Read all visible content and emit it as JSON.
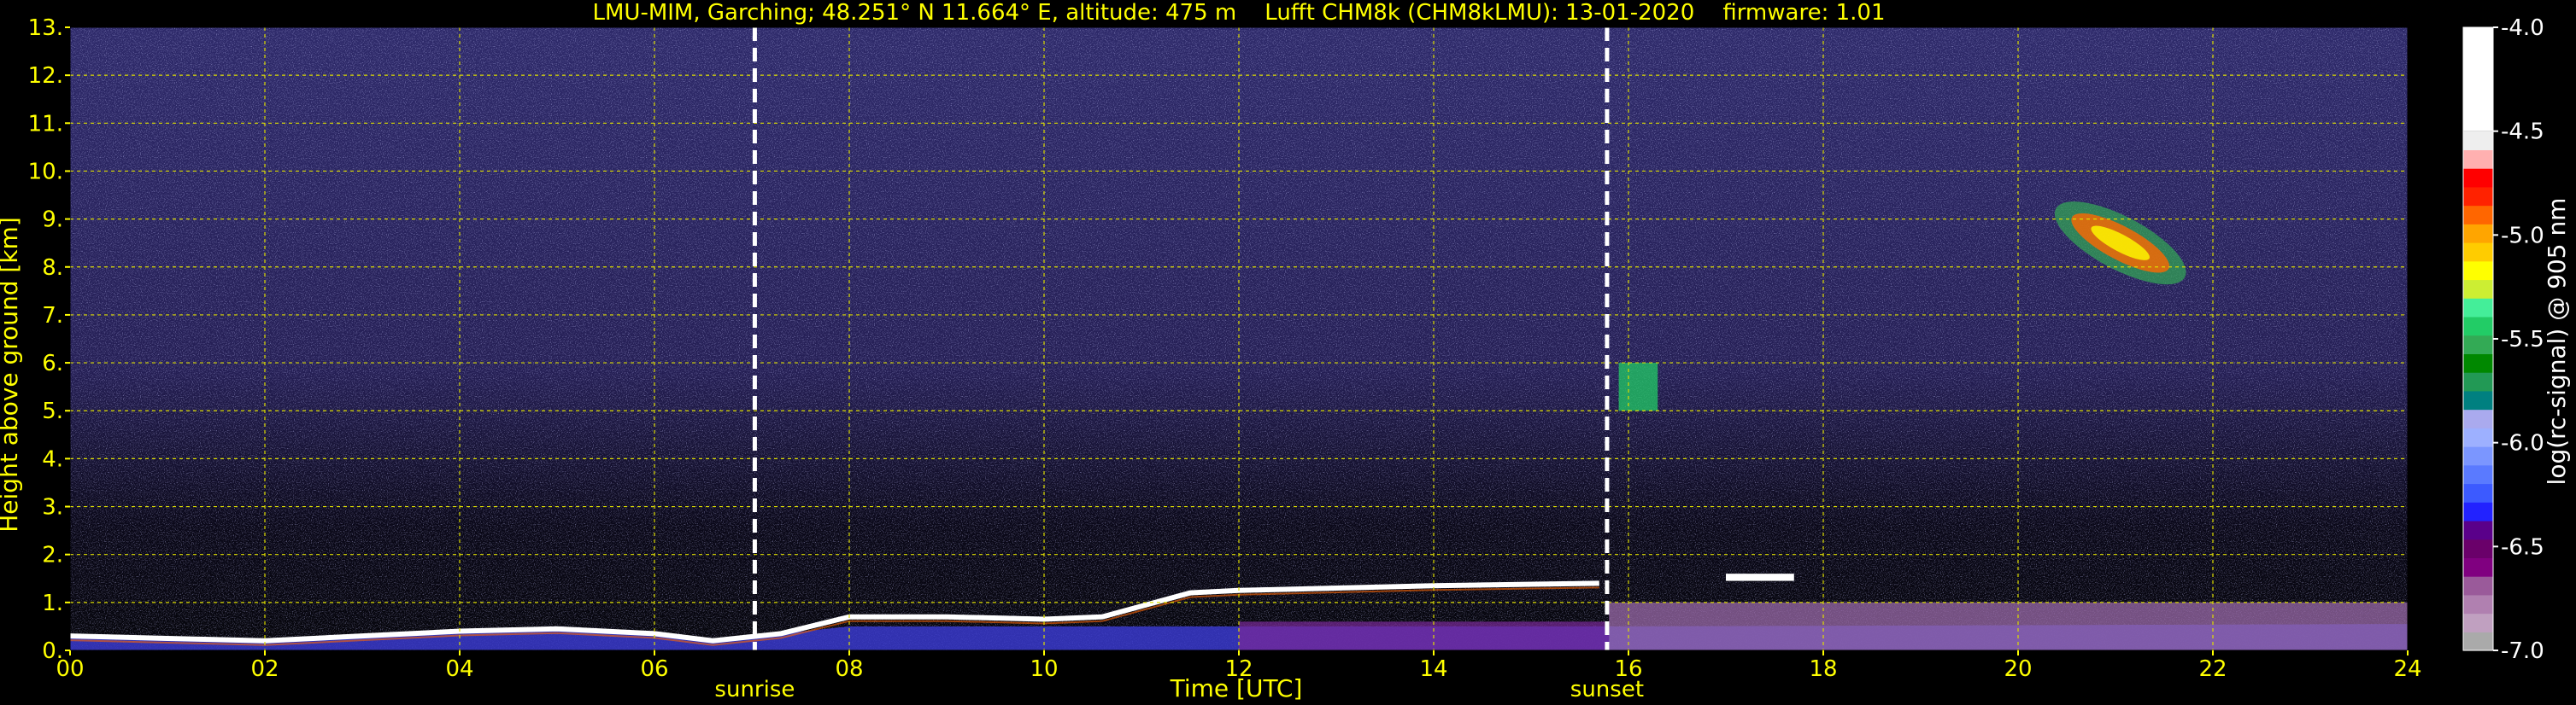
{
  "title": "LMU-MIM, Garching; 48.251° N 11.664° E, altitude: 475 m    Lufft CHM8k (CHM8kLMU): 13-01-2020    firmware: 1.01",
  "chart_data": {
    "type": "heatmap",
    "title": "LMU-MIM, Garching; 48.251° N 11.664° E, altitude: 475 m    Lufft CHM8k (CHM8kLMU): 13-01-2020    firmware: 1.01",
    "xlabel": "Time [UTC]",
    "ylabel": "Height above ground [km]",
    "xlim": [
      0,
      24
    ],
    "ylim": [
      0,
      13
    ],
    "x_ticks": [
      "00",
      "02",
      "04",
      "06",
      "08",
      "10",
      "12",
      "14",
      "16",
      "18",
      "20",
      "22",
      "24"
    ],
    "y_ticks": [
      "0.",
      "1.",
      "2.",
      "3.",
      "4.",
      "5.",
      "6.",
      "7.",
      "8.",
      "9.",
      "10.",
      "11.",
      "12.",
      "13."
    ],
    "grid": true,
    "colorbar": {
      "label": "log(rc-signal) @ 905 nm",
      "range": [
        -7.0,
        -4.0
      ],
      "ticks": [
        "-7.0",
        "-6.5",
        "-6.0",
        "-5.5",
        "-5.0",
        "-4.5",
        "-4.0"
      ],
      "colors": [
        "#aaaaaa",
        "#c0a0c0",
        "#b080b0",
        "#9a5a9a",
        "#800080",
        "#6a006a",
        "#5a008a",
        "#2222ff",
        "#3c5aff",
        "#5a7aff",
        "#7b96ff",
        "#9db0ff",
        "#aaaaee",
        "#008080",
        "#229955",
        "#008800",
        "#33aa55",
        "#22cc66",
        "#44ee99",
        "#ccee33",
        "#ffff00",
        "#ffcc00",
        "#ffa500",
        "#ff6600",
        "#ff2200",
        "#ff0000",
        "#ffb0b0",
        "#eeeeee",
        "#ffffff"
      ]
    },
    "vertical_markers": [
      {
        "label": "sunrise",
        "x": 7.03
      },
      {
        "label": "sunset",
        "x": 15.78
      }
    ],
    "features": [
      {
        "name": "boundary layer top",
        "points": [
          [
            0.0,
            0.3
          ],
          [
            1.0,
            0.25
          ],
          [
            2.0,
            0.2
          ],
          [
            3.0,
            0.3
          ],
          [
            4.0,
            0.4
          ],
          [
            5.0,
            0.45
          ],
          [
            6.0,
            0.35
          ],
          [
            6.6,
            0.2
          ],
          [
            7.3,
            0.35
          ],
          [
            8.0,
            0.7
          ],
          [
            9.0,
            0.7
          ],
          [
            10.0,
            0.65
          ],
          [
            10.6,
            0.7
          ],
          [
            11.5,
            1.2
          ],
          [
            12.0,
            1.25
          ],
          [
            13.0,
            1.3
          ],
          [
            14.0,
            1.35
          ],
          [
            15.7,
            1.4
          ]
        ]
      },
      {
        "name": "cirrus",
        "x_range": [
          20.3,
          21.8
        ],
        "y_range": [
          7.5,
          9.5
        ]
      },
      {
        "name": "cloud at 16h",
        "x_range": [
          15.9,
          16.3
        ],
        "y_range": [
          5.0,
          6.0
        ]
      },
      {
        "name": "cloud at 17-18h",
        "x_range": [
          17.0,
          17.7
        ],
        "y_range": [
          1.45,
          1.6
        ]
      }
    ]
  }
}
